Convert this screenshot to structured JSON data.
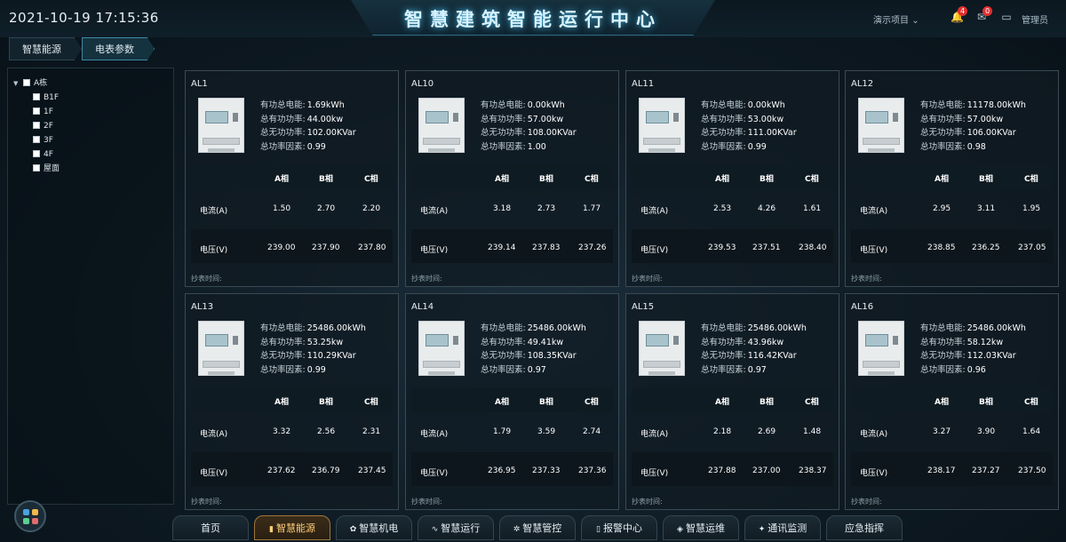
{
  "header": {
    "datetime": "2021-10-19 17:15:36",
    "title": "智慧建筑智能运行中心",
    "project": "演示项目",
    "user": "管理员",
    "notifications_count": "4",
    "messages_count": "0"
  },
  "breadcrumb": [
    "智慧能源",
    "电表参数"
  ],
  "tree": {
    "root": "A栋",
    "children": [
      "B1F",
      "1F",
      "2F",
      "3F",
      "4F",
      "屋面"
    ]
  },
  "labels": {
    "energy": "有功总电能:",
    "active_power": "总有功功率:",
    "reactive_power": "总无功功率:",
    "power_factor": "总功率因素:",
    "phase_a": "A相",
    "phase_b": "B相",
    "phase_c": "C相",
    "current": "电流(A)",
    "voltage": "电压(V)",
    "read_time": "抄表时间:"
  },
  "meters": [
    {
      "name": "AL1",
      "energy": "1.69kWh",
      "active": "44.00kw",
      "reactive": "102.00KVar",
      "pf": "0.99",
      "current": [
        "1.50",
        "2.70",
        "2.20"
      ],
      "voltage": [
        "239.00",
        "237.90",
        "237.80"
      ]
    },
    {
      "name": "AL10",
      "energy": "0.00kWh",
      "active": "57.00kw",
      "reactive": "108.00KVar",
      "pf": "1.00",
      "current": [
        "3.18",
        "2.73",
        "1.77"
      ],
      "voltage": [
        "239.14",
        "237.83",
        "237.26"
      ]
    },
    {
      "name": "AL11",
      "energy": "0.00kWh",
      "active": "53.00kw",
      "reactive": "111.00KVar",
      "pf": "0.99",
      "current": [
        "2.53",
        "4.26",
        "1.61"
      ],
      "voltage": [
        "239.53",
        "237.51",
        "238.40"
      ]
    },
    {
      "name": "AL12",
      "energy": "11178.00kWh",
      "active": "57.00kw",
      "reactive": "106.00KVar",
      "pf": "0.98",
      "current": [
        "2.95",
        "3.11",
        "1.95"
      ],
      "voltage": [
        "238.85",
        "236.25",
        "237.05"
      ]
    },
    {
      "name": "AL13",
      "energy": "25486.00kWh",
      "active": "53.25kw",
      "reactive": "110.29KVar",
      "pf": "0.99",
      "current": [
        "3.32",
        "2.56",
        "2.31"
      ],
      "voltage": [
        "237.62",
        "236.79",
        "237.45"
      ]
    },
    {
      "name": "AL14",
      "energy": "25486.00kWh",
      "active": "49.41kw",
      "reactive": "108.35KVar",
      "pf": "0.97",
      "current": [
        "1.79",
        "3.59",
        "2.74"
      ],
      "voltage": [
        "236.95",
        "237.33",
        "237.36"
      ]
    },
    {
      "name": "AL15",
      "energy": "25486.00kWh",
      "active": "43.96kw",
      "reactive": "116.42KVar",
      "pf": "0.97",
      "current": [
        "2.18",
        "2.69",
        "1.48"
      ],
      "voltage": [
        "237.88",
        "237.00",
        "238.37"
      ]
    },
    {
      "name": "AL16",
      "energy": "25486.00kWh",
      "active": "58.12kw",
      "reactive": "112.03KVar",
      "pf": "0.96",
      "current": [
        "3.27",
        "3.90",
        "1.64"
      ],
      "voltage": [
        "238.17",
        "237.27",
        "237.50"
      ]
    }
  ],
  "bottom_nav": [
    {
      "label": "首页",
      "icon": ""
    },
    {
      "label": "智慧能源",
      "icon": "chart-icon",
      "active": true
    },
    {
      "label": "智慧机电",
      "icon": "gear-icon"
    },
    {
      "label": "智慧运行",
      "icon": "pulse-icon"
    },
    {
      "label": "智慧管控",
      "icon": "cog-icon"
    },
    {
      "label": "报警中心",
      "icon": "alarm-icon"
    },
    {
      "label": "智慧运维",
      "icon": "layers-icon"
    },
    {
      "label": "通讯监测",
      "icon": "signal-icon"
    },
    {
      "label": "应急指挥",
      "icon": ""
    }
  ]
}
